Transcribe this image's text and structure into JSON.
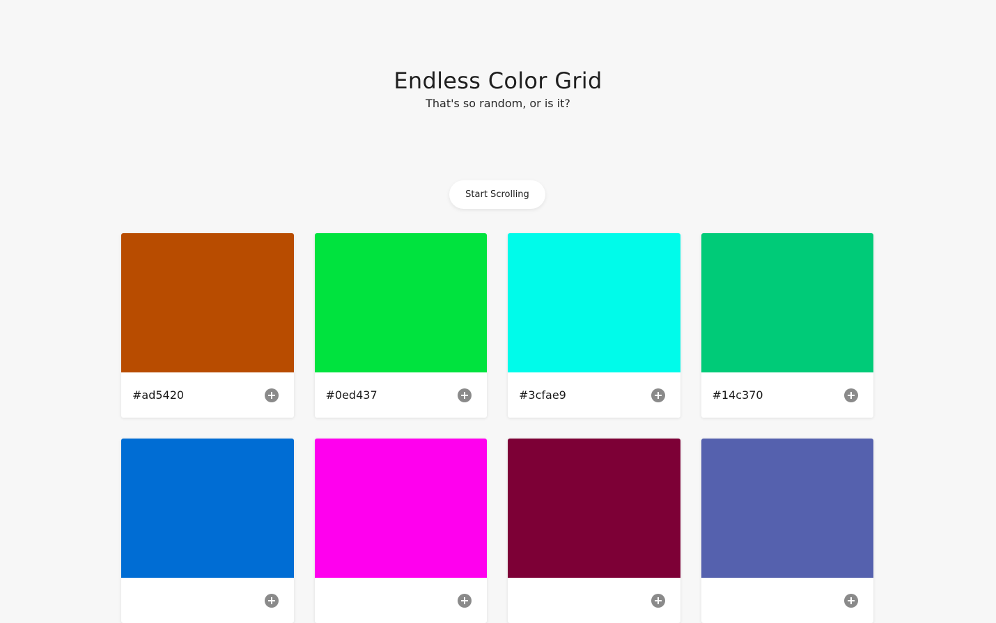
{
  "header": {
    "title": "Endless Color Grid",
    "subtitle": "That's so random, or is it?"
  },
  "actions": {
    "start_label": "Start Scrolling"
  },
  "icons": {
    "add": "plus-circle-icon"
  },
  "colors": [
    {
      "hex": "#ad5420",
      "swatch": "#b84c00"
    },
    {
      "hex": "#0ed437",
      "swatch": "#00e33e"
    },
    {
      "hex": "#3cfae9",
      "swatch": "#00fbea"
    },
    {
      "hex": "#14c370",
      "swatch": "#00cb78"
    },
    {
      "hex": "",
      "swatch": "#006dd4"
    },
    {
      "hex": "",
      "swatch": "#ff00ee"
    },
    {
      "hex": "",
      "swatch": "#7d0036"
    },
    {
      "hex": "",
      "swatch": "#5561ae"
    }
  ]
}
